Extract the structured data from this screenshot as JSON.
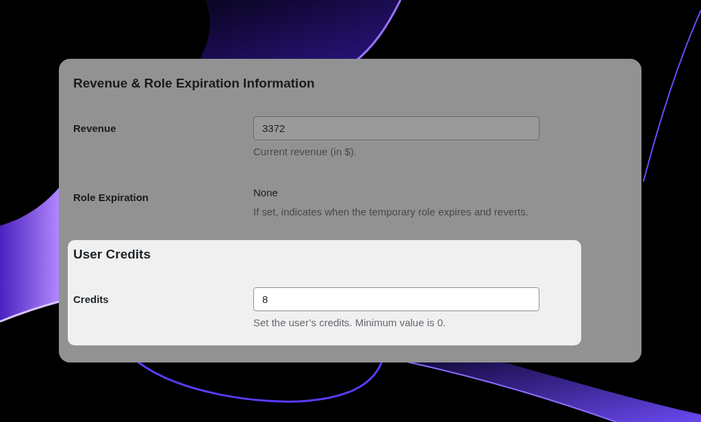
{
  "sections": [
    {
      "title": "Revenue & Role Expiration Information",
      "highlighted": false,
      "fields": [
        {
          "label": "Revenue",
          "kind": "input",
          "value": "3372",
          "description": "Current revenue (in $)."
        },
        {
          "label": "Role Expiration",
          "kind": "text",
          "value": "None",
          "description": "If set, indicates when the temporary role expires and reverts."
        }
      ]
    },
    {
      "title": "User Credits",
      "highlighted": true,
      "fields": [
        {
          "label": "Credits",
          "kind": "input",
          "value": "8",
          "description": "Set the user’s credits. Minimum value is 0."
        }
      ]
    }
  ]
}
